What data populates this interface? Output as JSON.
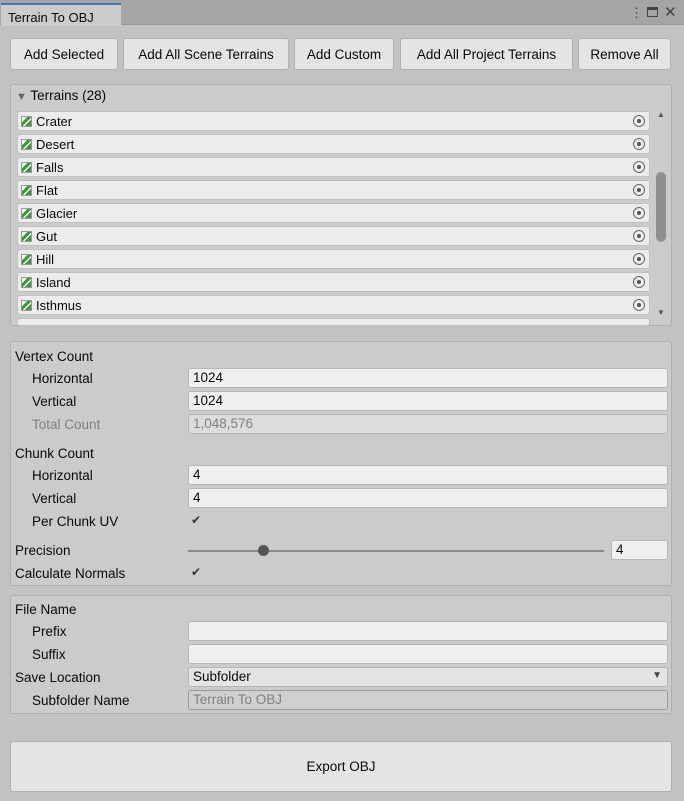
{
  "window": {
    "tab_title": "Terrain To OBJ"
  },
  "toolbar": {
    "add_selected": "Add Selected",
    "add_all_scene": "Add All Scene Terrains",
    "add_custom": "Add Custom",
    "add_all_project": "Add All Project Terrains",
    "remove_all": "Remove All"
  },
  "terrains": {
    "header": "Terrains (28)",
    "items": [
      "Crater",
      "Desert",
      "Falls",
      "Flat",
      "Glacier",
      "Gut",
      "Hill",
      "Island",
      "Isthmus"
    ]
  },
  "vertex": {
    "title": "Vertex Count",
    "horizontal_label": "Horizontal",
    "horizontal": "1024",
    "vertical_label": "Vertical",
    "vertical": "1024",
    "total_label": "Total Count",
    "total": "1,048,576"
  },
  "chunk": {
    "title": "Chunk Count",
    "horizontal_label": "Horizontal",
    "horizontal": "4",
    "vertical_label": "Vertical",
    "vertical": "4",
    "uv_label": "Per Chunk UV"
  },
  "precision": {
    "label": "Precision",
    "value": "4",
    "fraction": 0.18
  },
  "normals": {
    "label": "Calculate Normals"
  },
  "file": {
    "title": "File Name",
    "prefix_label": "Prefix",
    "prefix": "",
    "suffix_label": "Suffix",
    "suffix": "",
    "save_label": "Save Location",
    "save_value": "Subfolder",
    "subfolder_label": "Subfolder Name",
    "subfolder_placeholder": "Terrain To OBJ"
  },
  "export": {
    "label": "Export OBJ"
  }
}
